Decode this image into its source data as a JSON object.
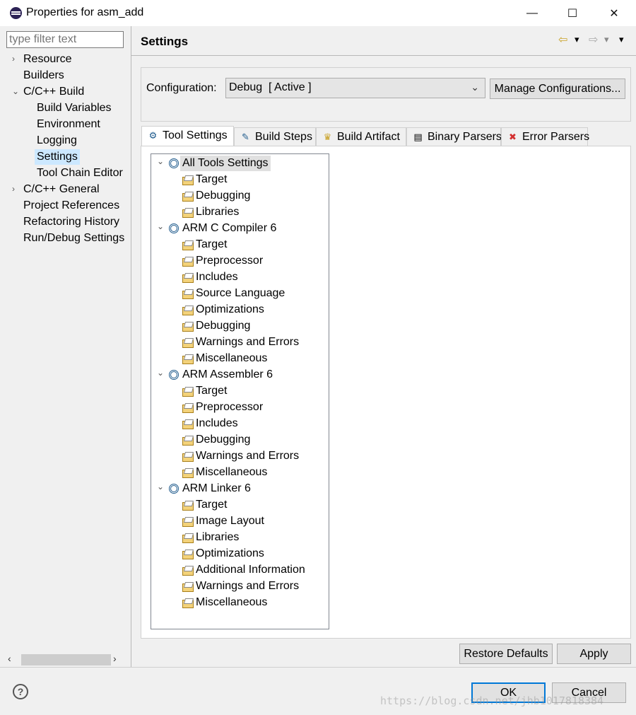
{
  "window": {
    "title": "Properties for asm_add",
    "minimize_glyph": "—",
    "maximize_glyph": "☐",
    "close_glyph": "✕"
  },
  "filter": {
    "placeholder": "type filter text"
  },
  "sidebar": {
    "items": [
      {
        "label": "Resource",
        "twisty": "›"
      },
      {
        "label": "Builders",
        "twisty": ""
      },
      {
        "label": "C/C++ Build",
        "twisty": "⌄"
      },
      {
        "label": "Build Variables",
        "twisty": ""
      },
      {
        "label": "Environment",
        "twisty": ""
      },
      {
        "label": "Logging",
        "twisty": ""
      },
      {
        "label": "Settings",
        "twisty": "",
        "selected": true
      },
      {
        "label": "Tool Chain Editor",
        "twisty": ""
      },
      {
        "label": "C/C++ General",
        "twisty": "›"
      },
      {
        "label": "Project References",
        "twisty": ""
      },
      {
        "label": "Refactoring History",
        "twisty": ""
      },
      {
        "label": "Run/Debug Settings",
        "twisty": ""
      }
    ],
    "scroll_left": "‹",
    "scroll_right": "›"
  },
  "header": {
    "title": "Settings",
    "back_glyph": "⇦",
    "forward_glyph": "⇨",
    "menu_glyph": "▾"
  },
  "config": {
    "label": "Configuration:",
    "selected": "Debug  [ Active ]",
    "chevron": "⌄",
    "manage_label": "Manage Configurations..."
  },
  "tabs": [
    {
      "label": "Tool Settings",
      "icon": "tool-settings-icon",
      "glyph": "⚙",
      "active": true
    },
    {
      "label": "Build Steps",
      "icon": "build-steps-icon",
      "glyph": "✎"
    },
    {
      "label": "Build Artifact",
      "icon": "build-artifact-icon",
      "glyph": "♛"
    },
    {
      "label": "Binary Parsers",
      "icon": "binary-parsers-icon",
      "glyph": "▤"
    },
    {
      "label": "Error Parsers",
      "icon": "error-parsers-icon",
      "glyph": "✖"
    }
  ],
  "tool_tree": [
    {
      "label": "All Tools Settings",
      "level": 0,
      "selected": true
    },
    {
      "label": "Target",
      "level": 1
    },
    {
      "label": "Debugging",
      "level": 1
    },
    {
      "label": "Libraries",
      "level": 1
    },
    {
      "label": "ARM C Compiler 6",
      "level": 0
    },
    {
      "label": "Target",
      "level": 1
    },
    {
      "label": "Preprocessor",
      "level": 1
    },
    {
      "label": "Includes",
      "level": 1
    },
    {
      "label": "Source Language",
      "level": 1
    },
    {
      "label": "Optimizations",
      "level": 1
    },
    {
      "label": "Debugging",
      "level": 1
    },
    {
      "label": "Warnings and Errors",
      "level": 1
    },
    {
      "label": "Miscellaneous",
      "level": 1
    },
    {
      "label": "ARM Assembler 6",
      "level": 0
    },
    {
      "label": "Target",
      "level": 1
    },
    {
      "label": "Preprocessor",
      "level": 1
    },
    {
      "label": "Includes",
      "level": 1
    },
    {
      "label": "Debugging",
      "level": 1
    },
    {
      "label": "Warnings and Errors",
      "level": 1
    },
    {
      "label": "Miscellaneous",
      "level": 1
    },
    {
      "label": "ARM Linker 6",
      "level": 0
    },
    {
      "label": "Target",
      "level": 1
    },
    {
      "label": "Image Layout",
      "level": 1
    },
    {
      "label": "Libraries",
      "level": 1
    },
    {
      "label": "Optimizations",
      "level": 1
    },
    {
      "label": "Additional Information",
      "level": 1
    },
    {
      "label": "Warnings and Errors",
      "level": 1
    },
    {
      "label": "Miscellaneous",
      "level": 1
    }
  ],
  "tree_expand_glyph": "⌄",
  "buttons": {
    "restore_defaults": "Restore Defaults",
    "apply": "Apply",
    "ok": "OK",
    "cancel": "Cancel",
    "help": "?"
  },
  "watermark": "https://blog.csdn.net/jhb1017818384"
}
